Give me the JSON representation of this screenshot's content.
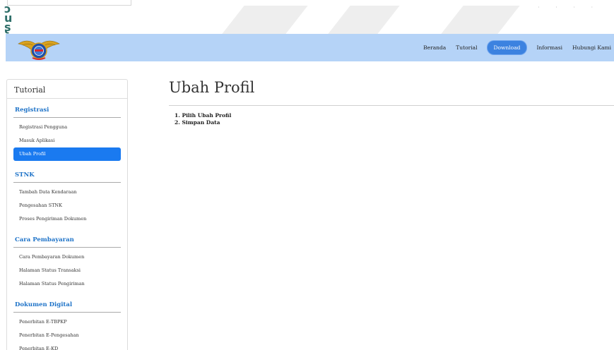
{
  "nav": {
    "items": [
      {
        "label": "Beranda",
        "active": false
      },
      {
        "label": "Tutorial",
        "active": false
      },
      {
        "label": "Download",
        "active": true
      },
      {
        "label": "Informasi",
        "active": false
      },
      {
        "label": "Hubungi Kami",
        "active": false
      }
    ]
  },
  "sidebar": {
    "title": "Tutorial",
    "sections": [
      {
        "heading": "Registrasi",
        "items": [
          {
            "label": "Registrasi Pengguna",
            "active": false
          },
          {
            "label": "Masuk Aplikasi",
            "active": false
          },
          {
            "label": "Ubah Profil",
            "active": true
          }
        ]
      },
      {
        "heading": "STNK",
        "items": [
          {
            "label": "Tambah Data Kendaraan",
            "active": false
          },
          {
            "label": "Pengesahan STNK",
            "active": false
          },
          {
            "label": "Proses Pengiriman Dokumen",
            "active": false
          }
        ]
      },
      {
        "heading": "Cara Pembayaran",
        "items": [
          {
            "label": "Cara Pembayaran Dokumen",
            "active": false
          },
          {
            "label": "Halaman Status Transaksi",
            "active": false
          },
          {
            "label": "Halaman Status Pengiriman",
            "active": false
          }
        ]
      },
      {
        "heading": "Dokumen Digital",
        "items": [
          {
            "label": "Penerbitan E-TBPKP",
            "active": false
          },
          {
            "label": "Penerbitan E-Pengesahan",
            "active": false
          },
          {
            "label": "Penerbitan E-KD",
            "active": false
          }
        ]
      }
    ]
  },
  "main": {
    "title": "Ubah Profil",
    "steps": [
      "1. Pilih Ubah Profil",
      "2. Simpan Data"
    ]
  },
  "colors": {
    "navbar_bg": "#b5d3f7",
    "active_nav": "#3c82e0",
    "active_sidebar": "#1a7af0",
    "section_heading": "#1e73c8"
  },
  "icons": {
    "logo": "police-emblem-logo"
  }
}
